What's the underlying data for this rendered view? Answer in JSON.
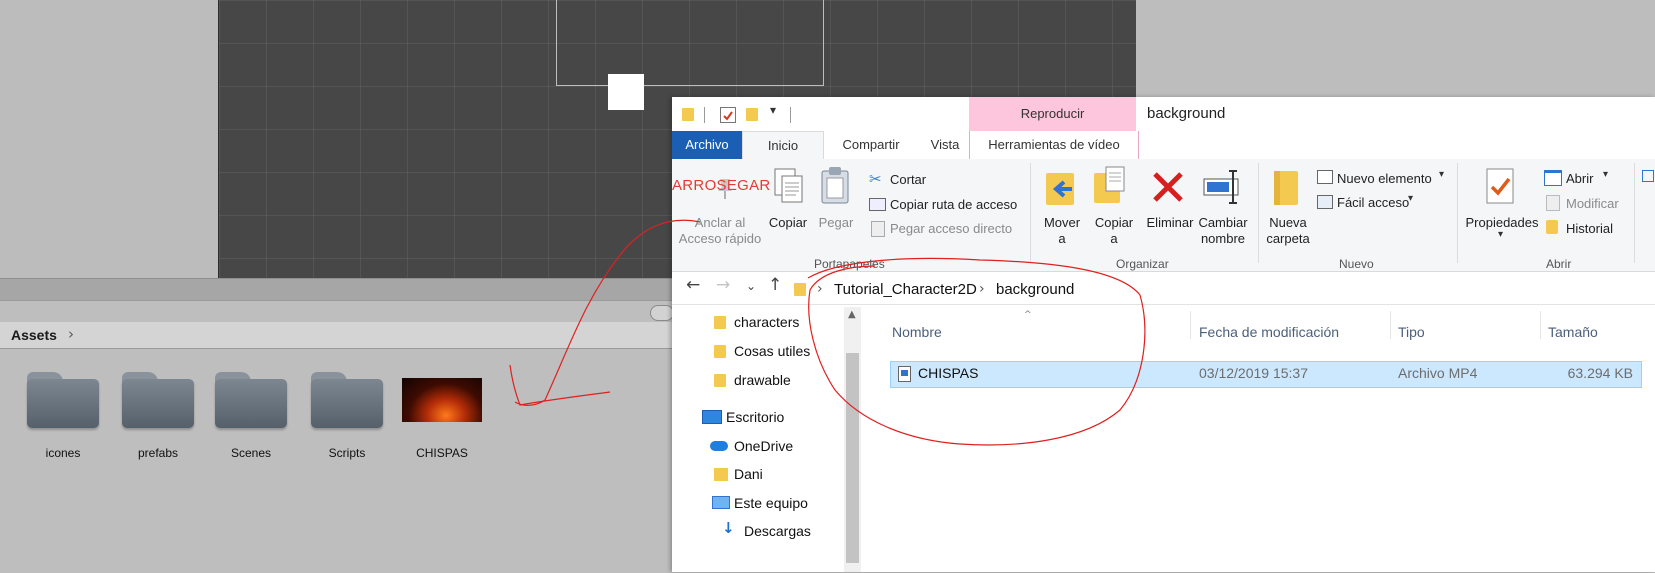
{
  "unity": {
    "assets_title": "Assets",
    "breadcrumb_chevron": "›",
    "assets": [
      {
        "label": "icones",
        "type": "folder"
      },
      {
        "label": "prefabs",
        "type": "folder"
      },
      {
        "label": "Scenes",
        "type": "folder"
      },
      {
        "label": "Scripts",
        "type": "folder"
      },
      {
        "label": "CHISPAS",
        "type": "video"
      }
    ]
  },
  "annotation": {
    "text": "ARROSEGAR",
    "color": "#e53935"
  },
  "explorer": {
    "context_tab": "Reproducir",
    "window_title": "background",
    "tabs": [
      "Archivo",
      "Inicio",
      "Compartir",
      "Vista",
      "Herramientas de vídeo"
    ],
    "ribbon": {
      "pin_label_1": "Anclar al",
      "pin_label_2": "Acceso rápido",
      "copy": "Copiar",
      "paste": "Pegar",
      "cut": "Cortar",
      "copy_path": "Copiar ruta de acceso",
      "paste_shortcut": "Pegar acceso directo",
      "group_clipboard": "Portapapeles",
      "move_1": "Mover",
      "move_2": "a",
      "copyto_1": "Copiar",
      "copyto_2": "a",
      "delete": "Eliminar",
      "rename_1": "Cambiar",
      "rename_2": "nombre",
      "group_organize": "Organizar",
      "newfolder_1": "Nueva",
      "newfolder_2": "carpeta",
      "new_item": "Nuevo elemento",
      "easy_access": "Fácil acceso",
      "group_new": "Nuevo",
      "properties": "Propiedades",
      "open": "Abrir",
      "edit": "Modificar",
      "history": "Historial",
      "group_open": "Abrir"
    },
    "breadcrumb": [
      "Tutorial_Character2D",
      "background"
    ],
    "nav_items": [
      {
        "label": "characters",
        "icon": "folder-icon"
      },
      {
        "label": "Cosas utiles",
        "icon": "folder-icon"
      },
      {
        "label": "drawable",
        "icon": "folder-icon"
      },
      {
        "label": "Escritorio",
        "icon": "desktop-icon"
      },
      {
        "label": "OneDrive",
        "icon": "cloud-icon"
      },
      {
        "label": "Dani",
        "icon": "user-folder-icon"
      },
      {
        "label": "Este equipo",
        "icon": "computer-icon"
      },
      {
        "label": "Descargas",
        "icon": "download-icon"
      }
    ],
    "columns": [
      "Nombre",
      "Fecha de modificación",
      "Tipo",
      "Tamaño"
    ],
    "files": [
      {
        "name": "CHISPAS",
        "date": "03/12/2019 15:37",
        "type": "Archivo MP4",
        "size": "63.294 KB"
      }
    ]
  }
}
